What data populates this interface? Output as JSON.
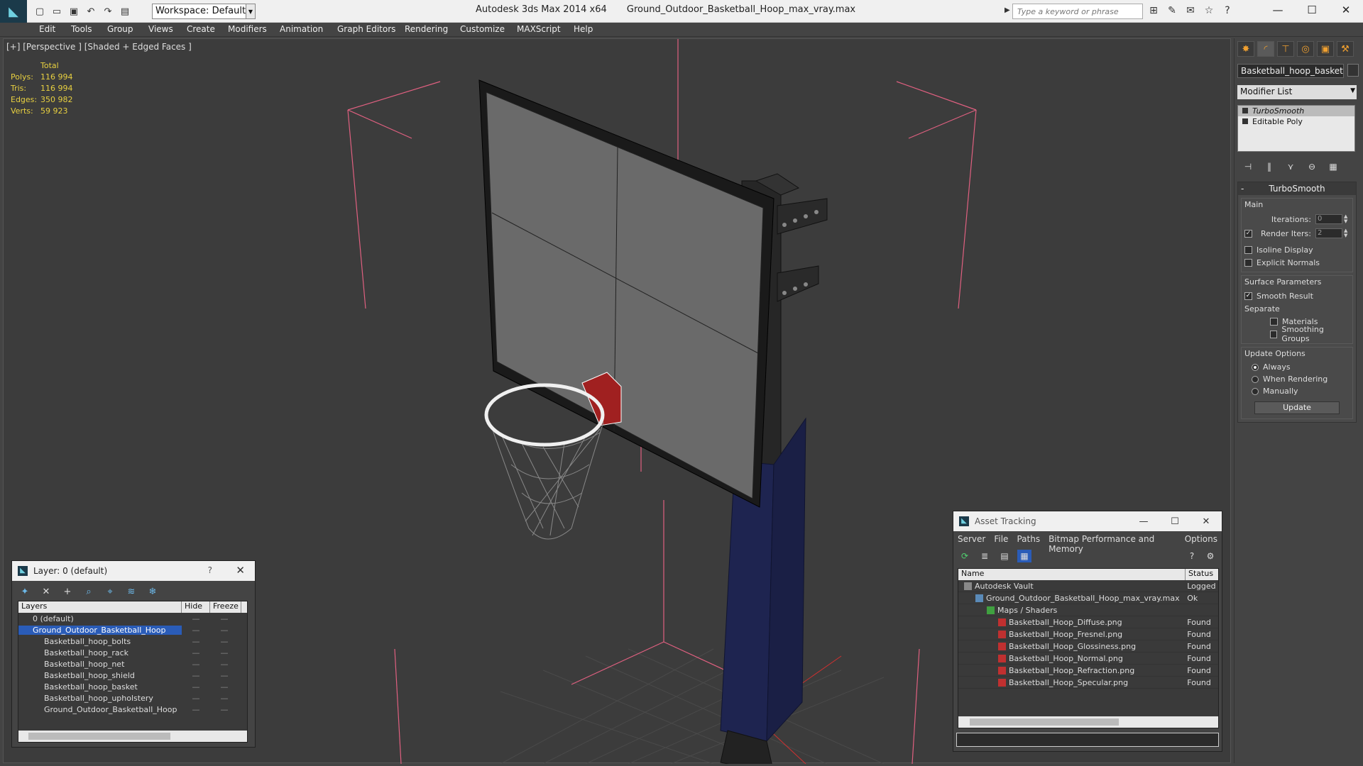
{
  "titlebar": {
    "app_title": "Autodesk 3ds Max  2014 x64",
    "file_title": "Ground_Outdoor_Basketball_Hoop_max_vray.max",
    "workspace": "Workspace: Default",
    "search_placeholder": "Type a keyword or phrase"
  },
  "menu": [
    "Edit",
    "Tools",
    "Group",
    "Views",
    "Create",
    "Modifiers",
    "Animation",
    "Graph Editors",
    "Rendering",
    "Customize",
    "MAXScript",
    "Help"
  ],
  "viewport": {
    "label": "[+] [Perspective ] [Shaded + Edged Faces ]",
    "stats": {
      "header": "Total",
      "polys_label": "Polys:",
      "polys": "116 994",
      "tris_label": "Tris:",
      "tris": "116 994",
      "edges_label": "Edges:",
      "edges": "350 982",
      "verts_label": "Verts:",
      "verts": "59 923"
    }
  },
  "command_panel": {
    "object_name": "Basketball_hoop_basket",
    "modifier_list": "Modifier List",
    "stack": [
      "TurboSmooth",
      "Editable Poly"
    ],
    "rollout_title": "TurboSmooth",
    "main_group": "Main",
    "iterations_label": "Iterations:",
    "iterations": "0",
    "render_iters_label": "Render Iters:",
    "render_iters": "2",
    "isoline": "Isoline Display",
    "explicit_normals": "Explicit Normals",
    "surface_group": "Surface Parameters",
    "smooth_result": "Smooth Result",
    "separate": "Separate",
    "materials": "Materials",
    "smoothing_groups": "Smoothing Groups",
    "update_group": "Update Options",
    "always": "Always",
    "when_rendering": "When Rendering",
    "manually": "Manually",
    "update_btn": "Update"
  },
  "layer_window": {
    "title": "Layer: 0 (default)",
    "help": "?",
    "col_layers": "Layers",
    "col_hide": "Hide",
    "col_freeze": "Freeze",
    "rows": [
      "0 (default)",
      "Ground_Outdoor_Basketball_Hoop",
      "Basketball_hoop_bolts",
      "Basketball_hoop_rack",
      "Basketball_hoop_net",
      "Basketball_hoop_shield",
      "Basketball_hoop_basket",
      "Basketball_hoop_upholstery",
      "Ground_Outdoor_Basketball_Hoop"
    ]
  },
  "asset_window": {
    "title": "Asset Tracking",
    "menu": [
      "Server",
      "File",
      "Paths",
      "Bitmap Performance and Memory",
      "Options"
    ],
    "col_name": "Name",
    "col_status": "Status",
    "rows": [
      {
        "name": "Autodesk Vault",
        "status": "Logged"
      },
      {
        "name": "Ground_Outdoor_Basketball_Hoop_max_vray.max",
        "status": "Ok"
      },
      {
        "name": "Maps / Shaders",
        "status": ""
      },
      {
        "name": "Basketball_Hoop_Diffuse.png",
        "status": "Found"
      },
      {
        "name": "Basketball_Hoop_Fresnel.png",
        "status": "Found"
      },
      {
        "name": "Basketball_Hoop_Glossiness.png",
        "status": "Found"
      },
      {
        "name": "Basketball_Hoop_Normal.png",
        "status": "Found"
      },
      {
        "name": "Basketball_Hoop_Refraction.png",
        "status": "Found"
      },
      {
        "name": "Basketball_Hoop_Specular.png",
        "status": "Found"
      }
    ]
  },
  "colors": {
    "selection_box": "#e06080",
    "stats_text": "#e8d040",
    "upholstery": "#1e2450",
    "rim_red": "#a02020"
  }
}
